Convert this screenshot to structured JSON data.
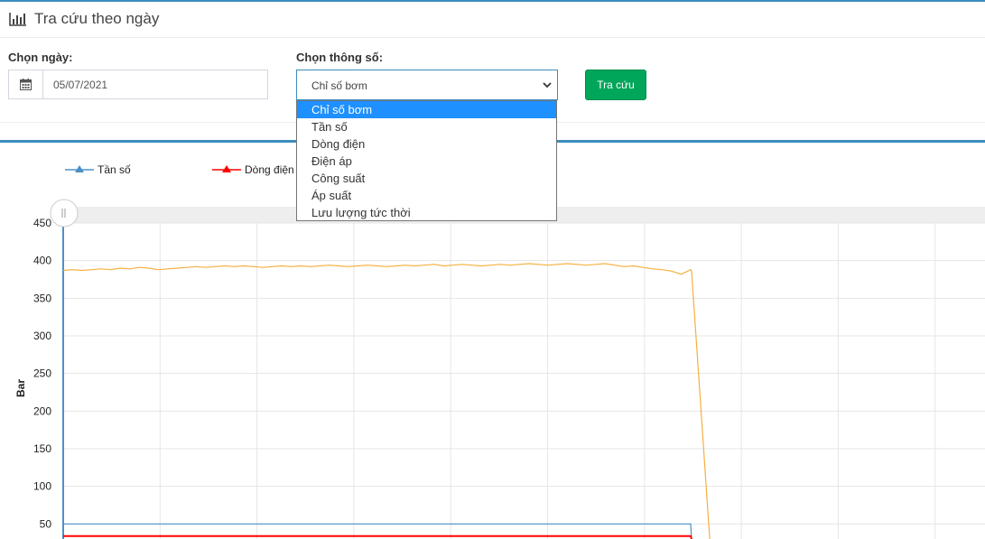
{
  "header": {
    "title": "Tra cứu theo ngày",
    "icon": "bar-chart-icon"
  },
  "form": {
    "date_label": "Chọn ngày:",
    "date_value": "05/07/2021",
    "param_label": "Chọn thông số:",
    "param_value": "Chỉ số bơm",
    "search_button": "Tra cứu",
    "options": [
      "Chỉ số bơm",
      "Tần số",
      "Dòng điện",
      "Điện áp",
      "Công suất",
      "Áp suất",
      "Lưu lượng tức thời"
    ],
    "selected_index": 0
  },
  "colors": {
    "accent": "#3c8dbc",
    "button": "#00a65a",
    "selected_option": "#1e90ff"
  },
  "chart_data": {
    "type": "line",
    "ylabel": "Bar",
    "ylim": [
      30,
      450
    ],
    "yticks": [
      50,
      100,
      150,
      200,
      250,
      300,
      350,
      400,
      450
    ],
    "grid": true,
    "legend_position": "top-left",
    "series": [
      {
        "name": "Tần số",
        "color": "#4a90c8",
        "values": [
          50,
          50,
          50,
          50,
          50,
          50,
          50,
          50,
          50,
          50,
          50,
          50,
          50,
          50,
          50,
          50,
          50,
          50,
          50,
          50,
          50,
          50,
          50,
          50,
          50,
          50,
          50,
          50,
          50,
          50,
          50,
          50,
          50,
          50,
          50,
          50,
          50,
          50,
          50,
          50,
          50,
          50,
          50,
          50,
          50,
          50,
          50,
          50,
          50,
          50,
          50,
          50,
          50,
          50,
          50,
          50,
          50,
          50,
          50,
          50,
          50,
          50,
          50,
          50,
          50,
          50,
          50,
          0
        ]
      },
      {
        "name": "Dòng điện",
        "color": "#ff0000",
        "values": [
          34,
          34,
          34,
          34,
          34,
          34,
          34,
          34,
          34,
          34,
          34,
          34,
          34,
          34,
          34,
          34,
          34,
          34,
          34,
          34,
          34,
          34,
          34,
          34,
          34,
          34,
          34,
          34,
          34,
          34,
          34,
          34,
          34,
          34,
          34,
          34,
          34,
          34,
          34,
          34,
          34,
          34,
          34,
          34,
          34,
          34,
          34,
          34,
          34,
          34,
          34,
          34,
          34,
          34,
          34,
          34,
          34,
          34,
          34,
          34,
          34,
          34,
          34,
          34,
          34,
          34,
          34,
          0
        ]
      },
      {
        "name": "",
        "color": "#f5b041",
        "values": [
          387,
          388,
          387,
          388,
          389,
          388,
          390,
          389,
          391,
          390,
          388,
          389,
          390,
          391,
          392,
          391,
          392,
          393,
          392,
          393,
          392,
          391,
          392,
          393,
          392,
          393,
          392,
          393,
          394,
          393,
          392,
          393,
          394,
          393,
          392,
          393,
          394,
          393,
          394,
          395,
          393,
          394,
          395,
          394,
          393,
          394,
          395,
          394,
          395,
          396,
          395,
          394,
          395,
          396,
          395,
          394,
          395,
          396,
          394,
          392,
          393,
          391,
          389,
          388,
          386,
          382,
          388,
          386,
          0
        ]
      }
    ]
  }
}
